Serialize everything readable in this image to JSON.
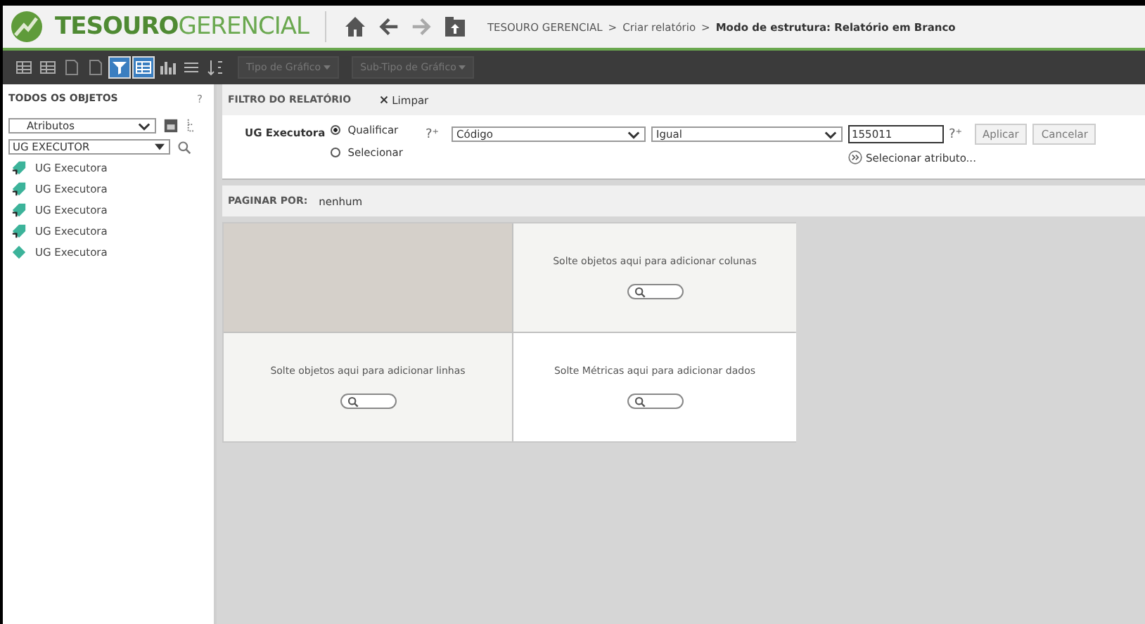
{
  "header": {
    "brand_bold": "TESOURO",
    "brand_light": "GERENCIAL",
    "breadcrumb": [
      "TESOURO GERENCIAL",
      "Criar relatório"
    ],
    "separator": ">",
    "current": "Modo de estrutura: Relatório em Branco"
  },
  "toolbar": {
    "buttons": [
      {
        "selected": false
      },
      {
        "selected": false
      },
      {
        "selected": false
      },
      {
        "selected": false
      },
      {
        "selected": true
      },
      {
        "selected": true
      },
      {
        "selected": false
      },
      {
        "selected": false
      },
      {
        "selected": false
      }
    ],
    "dropdowns": [
      {
        "label": "Tipo de Gráfico",
        "disabled": true
      },
      {
        "label": "Sub-Tipo de Gráfico",
        "disabled": true
      }
    ]
  },
  "sidebar": {
    "title": "TODOS OS OBJETOS",
    "help": "?",
    "type_select": "Atributos",
    "search_value": "UG EXECUTOR",
    "items": [
      {
        "label": "UG Executora",
        "kind": "shortcut"
      },
      {
        "label": "UG Executora",
        "kind": "shortcut"
      },
      {
        "label": "UG Executora",
        "kind": "shortcut"
      },
      {
        "label": "UG Executora",
        "kind": "shortcut"
      },
      {
        "label": "UG Executora",
        "kind": "attribute"
      }
    ]
  },
  "filter": {
    "title": "FILTRO DO RELATÓRIO",
    "clear": "Limpar",
    "attribute": "UG Executora",
    "modes": [
      {
        "label": "Qualificar",
        "selected": true
      },
      {
        "label": "Selecionar",
        "selected": false
      }
    ],
    "prompt": "?⁺",
    "field": "Código",
    "operator": "Igual",
    "value": "155011",
    "apply": "Aplicar",
    "cancel": "Cancelar",
    "select_attribute": "Selecionar atributo..."
  },
  "paging": {
    "label": "PAGINAR POR:",
    "value": "nenhum"
  },
  "grid": {
    "columns_hint": "Solte objetos aqui para adicionar colunas",
    "rows_hint": "Solte objetos aqui para adicionar linhas",
    "data_hint": "Solte Métricas aqui para adicionar dados"
  }
}
